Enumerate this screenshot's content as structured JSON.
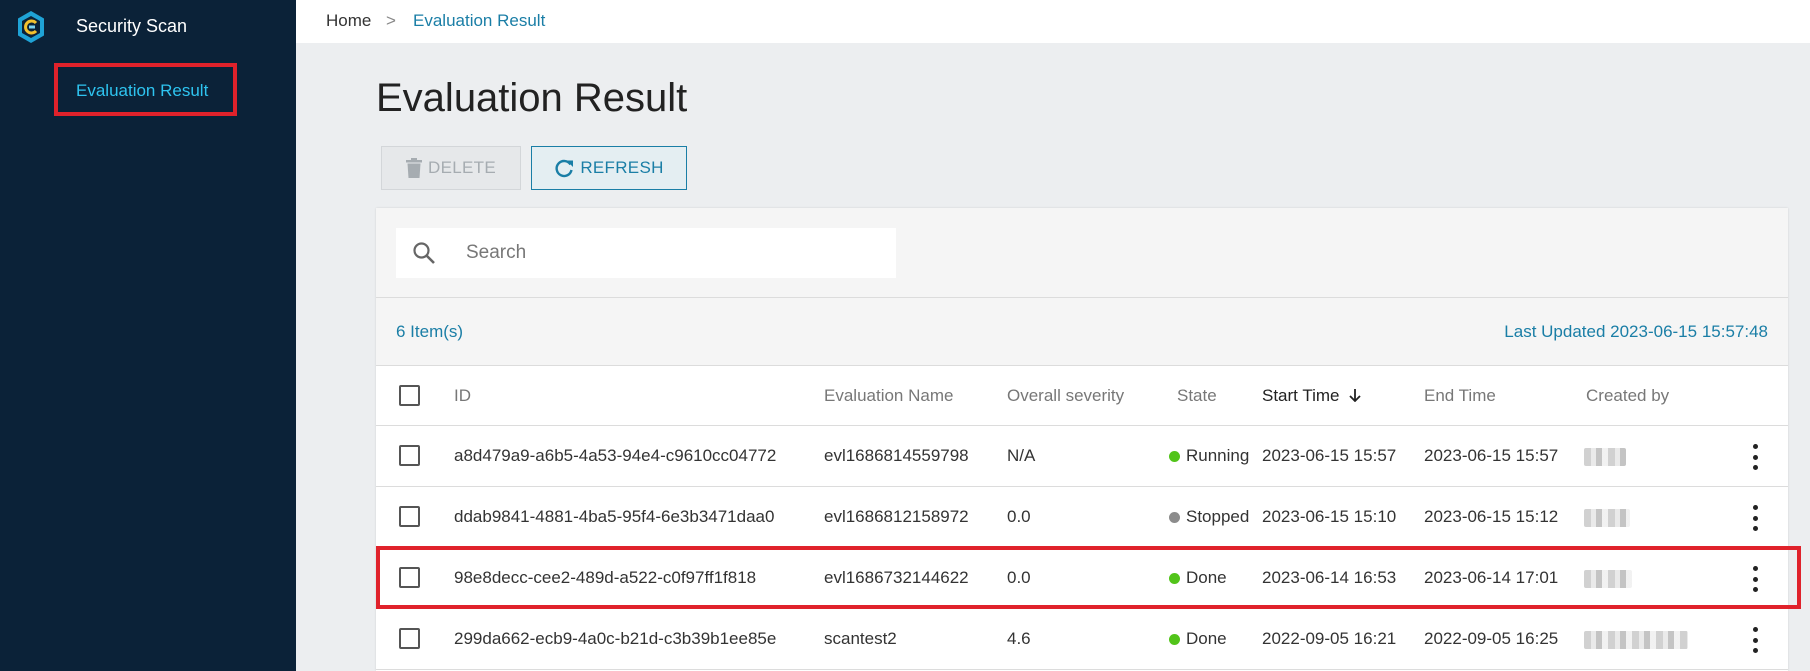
{
  "sidebar": {
    "app_title": "Security Scan",
    "items": [
      {
        "label": "Evaluation Result"
      }
    ]
  },
  "breadcrumb": {
    "home": "Home",
    "separator": ">",
    "current": "Evaluation Result"
  },
  "page": {
    "title": "Evaluation Result"
  },
  "toolbar": {
    "delete_label": "DELETE",
    "refresh_label": "REFRESH"
  },
  "search": {
    "placeholder": "Search",
    "value": ""
  },
  "summary": {
    "item_count": "6 Item(s)",
    "last_updated": "Last Updated 2023-06-15 15:57:48"
  },
  "table": {
    "columns": {
      "id": "ID",
      "evaluation_name": "Evaluation Name",
      "overall_severity": "Overall severity",
      "state": "State",
      "start_time": "Start Time",
      "end_time": "End Time",
      "created_by": "Created by"
    },
    "sort_column": "start_time",
    "sort_direction": "descending",
    "rows": [
      {
        "id": "a8d479a9-a6b5-4a53-94e4-c9610cc04772",
        "evaluation_name": "evl1686814559798",
        "overall_severity": "N/A",
        "state": "Running",
        "state_color": "#52c41a",
        "start_time": "2023-06-15 15:57",
        "end_time": "2023-06-15 15:57"
      },
      {
        "id": "ddab9841-4881-4ba5-95f4-6e3b3471daa0",
        "evaluation_name": "evl1686812158972",
        "overall_severity": "0.0",
        "state": "Stopped",
        "state_color": "#8c8c8c",
        "start_time": "2023-06-15 15:10",
        "end_time": "2023-06-15 15:12"
      },
      {
        "id": "98e8decc-cee2-489d-a522-c0f97ff1f818",
        "evaluation_name": "evl1686732144622",
        "overall_severity": "0.0",
        "state": "Done",
        "state_color": "#52c41a",
        "start_time": "2023-06-14 16:53",
        "end_time": "2023-06-14 17:01"
      },
      {
        "id": "299da662-ecb9-4a0c-b21d-c3b39b1ee85e",
        "evaluation_name": "scantest2",
        "overall_severity": "4.6",
        "state": "Done",
        "state_color": "#52c41a",
        "start_time": "2022-09-05 16:21",
        "end_time": "2022-09-05 16:25"
      }
    ]
  },
  "colors": {
    "sidebar_bg": "#0b2238",
    "accent": "#1a7ea6",
    "highlight": "#e0222b",
    "nav_active": "#2ec4f0"
  },
  "icons": {
    "logo": "security-scan-logo-icon",
    "delete": "trash-icon",
    "refresh": "refresh-icon",
    "search": "search-icon",
    "sort": "arrow-down-icon",
    "row_menu": "kebab-menu-icon"
  }
}
